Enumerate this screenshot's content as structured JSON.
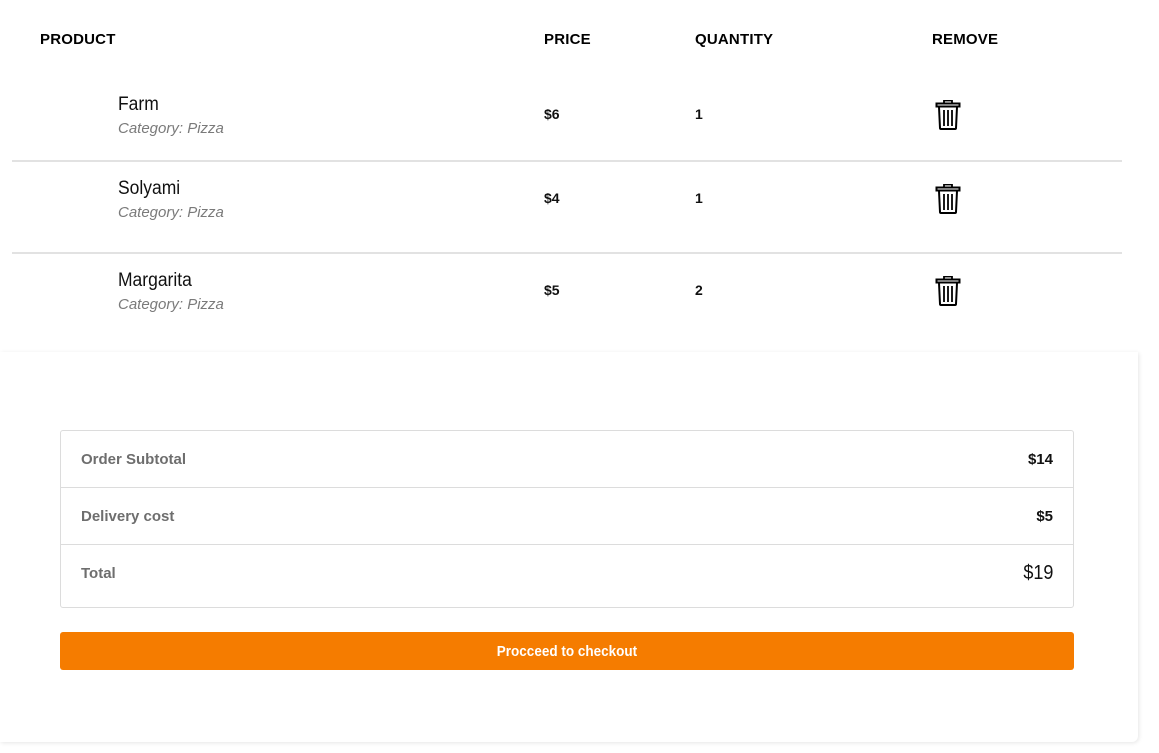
{
  "table": {
    "headers": {
      "product": "PRODUCT",
      "price": "PRICE",
      "quantity": "QUANTITY",
      "remove": "REMOVE"
    },
    "rows": [
      {
        "name": "Farm",
        "category": "Category: Pizza",
        "price": "$6",
        "quantity": "1",
        "remove_icon": "trash-icon"
      },
      {
        "name": "Solyami",
        "category": "Category: Pizza",
        "price": "$4",
        "quantity": "1",
        "remove_icon": "trash-icon"
      },
      {
        "name": "Margarita",
        "category": "Category: Pizza",
        "price": "$5",
        "quantity": "2",
        "remove_icon": "trash-icon"
      }
    ]
  },
  "summary": {
    "subtotal_label": "Order Subtotal",
    "subtotal_value": "$14",
    "delivery_label": "Delivery cost",
    "delivery_value": "$5",
    "total_label": "Total",
    "total_value": "$19"
  },
  "checkout": {
    "label": "Procceed to checkout",
    "color": "#f57c00"
  }
}
